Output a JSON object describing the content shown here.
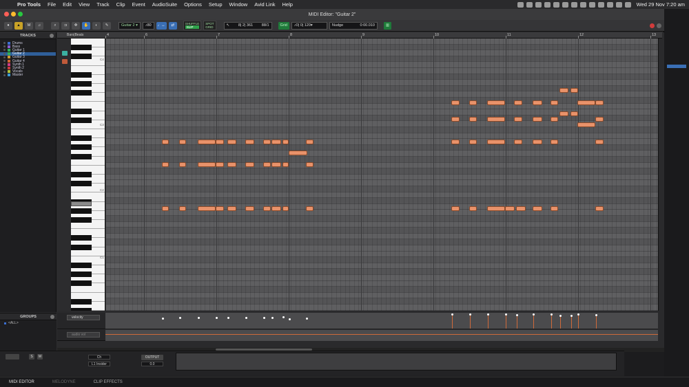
{
  "menubar": {
    "app": "Pro Tools",
    "items": [
      "File",
      "Edit",
      "View",
      "Track",
      "Clip",
      "Event",
      "AudioSuite",
      "Options",
      "Setup",
      "Window",
      "Avid Link",
      "Help"
    ],
    "clock": "Wed 29 Nov  7:20 am"
  },
  "window": {
    "title": "MIDI Editor: \"Guitar 2\""
  },
  "toolbar": {
    "track_select": "Guitar 2",
    "velocity": "80",
    "mode_shuffle": "SHUFFLE",
    "mode_slip": "SLIP",
    "mode_spot": "SPOT",
    "mode_grid": "GRID",
    "counter": "8| 2| 361",
    "length": "88/1",
    "grid_label": "Grid",
    "grid_value": "0| 0| 120",
    "nudge_label": "Nudge",
    "nudge_value": "0:00.010"
  },
  "tracks_panel": {
    "header": "TRACKS",
    "tracks": [
      {
        "name": "Drums",
        "color": "#3b6fd0"
      },
      {
        "name": "Bass",
        "color": "#8a5cd0"
      },
      {
        "name": "Guitar 1",
        "color": "#2fb05a"
      },
      {
        "name": "Guitar 2",
        "color": "#2fb05a",
        "selected": true
      },
      {
        "name": "Guitar 3",
        "color": "#d09a2f"
      },
      {
        "name": "Guitar 4",
        "color": "#d0642f"
      },
      {
        "name": "Synth 1",
        "color": "#d03b8a"
      },
      {
        "name": "Synth 2",
        "color": "#c83b3b"
      },
      {
        "name": "Vocals",
        "color": "#b0c03b"
      },
      {
        "name": "Master",
        "color": "#3b9ad0"
      }
    ]
  },
  "groups_panel": {
    "header": "GROUPS",
    "item": "<ALL>"
  },
  "ruler": {
    "label": "Bars|Beats",
    "bars": [
      "4",
      "6",
      "7",
      "8",
      "9",
      "10",
      "11",
      "12",
      "13"
    ]
  },
  "piano": {
    "octave_labels": [
      "C4",
      "C3",
      "C2",
      "C1"
    ]
  },
  "lanes": {
    "velocity_label": "velocity",
    "audio_label": "audio vol"
  },
  "bottom": {
    "s": "S",
    "m": "M",
    "output_label": "OUTPUT",
    "output_value": "0.0",
    "channel": "Ch",
    "insert": "L1 Insider"
  },
  "tabs": [
    "MIDI EDITOR",
    "MELODYNE",
    "CLIP EFFECTS"
  ]
}
